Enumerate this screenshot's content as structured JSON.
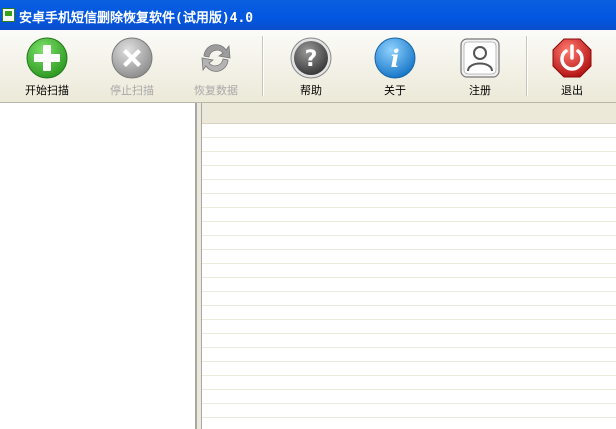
{
  "window": {
    "title": "安卓手机短信删除恢复软件(试用版)4.0"
  },
  "toolbar": {
    "buttons": [
      {
        "id": "start_scan",
        "label": "开始扫描",
        "icon": "plus-circle-icon",
        "color": "#3caf2c",
        "enabled": true
      },
      {
        "id": "stop_scan",
        "label": "停止扫描",
        "icon": "x-circle-icon",
        "color": "#9a9a9a",
        "enabled": false
      },
      {
        "id": "recover_data",
        "label": "恢复数据",
        "icon": "refresh-icon",
        "color": "#9a9a9a",
        "enabled": false
      },
      {
        "id": "help",
        "label": "帮助",
        "icon": "question-icon",
        "color": "#555555",
        "enabled": true
      },
      {
        "id": "about",
        "label": "关于",
        "icon": "info-icon",
        "color": "#2a8ed8",
        "enabled": true
      },
      {
        "id": "register",
        "label": "注册",
        "icon": "user-icon",
        "color": "#666666",
        "enabled": true
      },
      {
        "id": "exit",
        "label": "退出",
        "icon": "power-icon",
        "color": "#d0201e",
        "enabled": true
      }
    ]
  }
}
